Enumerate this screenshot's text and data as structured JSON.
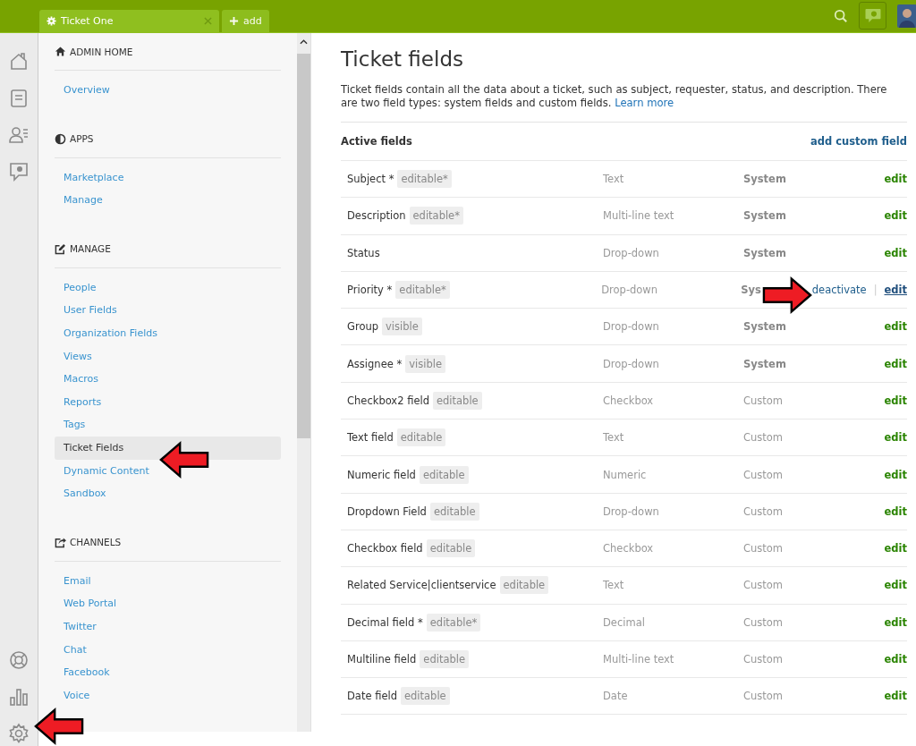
{
  "tabs": [
    {
      "label": "Ticket One",
      "selected": true,
      "closable": true
    },
    {
      "label": "add",
      "selected": false,
      "closable": false
    }
  ],
  "rail": {
    "top": [
      {
        "kind": "home"
      },
      {
        "kind": "tickets"
      },
      {
        "kind": "users"
      },
      {
        "kind": "chat"
      }
    ],
    "bottom": [
      {
        "kind": "help"
      },
      {
        "kind": "chart"
      },
      {
        "kind": "gear"
      }
    ]
  },
  "sidebar": {
    "sections": [
      {
        "kind": "home",
        "heading": "ADMIN HOME",
        "items": [
          {
            "label": "Overview",
            "selected": false
          }
        ]
      },
      {
        "kind": "apps",
        "heading": "APPS",
        "items": [
          {
            "label": "Marketplace",
            "selected": false
          },
          {
            "label": "Manage",
            "selected": false
          }
        ]
      },
      {
        "kind": "edit",
        "heading": "MANAGE",
        "items": [
          {
            "label": "People",
            "selected": false
          },
          {
            "label": "User Fields",
            "selected": false
          },
          {
            "label": "Organization Fields",
            "selected": false
          },
          {
            "label": "Views",
            "selected": false
          },
          {
            "label": "Macros",
            "selected": false
          },
          {
            "label": "Reports",
            "selected": false
          },
          {
            "label": "Tags",
            "selected": false
          },
          {
            "label": "Ticket Fields",
            "selected": true
          },
          {
            "label": "Dynamic Content",
            "selected": false
          },
          {
            "label": "Sandbox",
            "selected": false
          }
        ]
      },
      {
        "kind": "share",
        "heading": "CHANNELS",
        "items": [
          {
            "label": "Email",
            "selected": false
          },
          {
            "label": "Web Portal",
            "selected": false
          },
          {
            "label": "Twitter",
            "selected": false
          },
          {
            "label": "Chat",
            "selected": false
          },
          {
            "label": "Facebook",
            "selected": false
          },
          {
            "label": "Voice",
            "selected": false
          }
        ]
      }
    ]
  },
  "page": {
    "title": "Ticket fields",
    "description": "Ticket fields contain all the data about a ticket, such as subject, requester, status, and description. There are two field types: system fields and custom fields.",
    "learn_more": "Learn more"
  },
  "table": {
    "heading": "Active fields",
    "add_link": "add custom field",
    "rows": [
      {
        "name": "Subject *",
        "tag": "editable*",
        "type": "Text",
        "category": "System",
        "kind": "system",
        "hovered": false,
        "action": "edit"
      },
      {
        "name": "Description",
        "tag": "editable*",
        "type": "Multi-line text",
        "category": "System",
        "kind": "system",
        "hovered": false,
        "action": "edit"
      },
      {
        "name": "Status",
        "type": "Drop-down",
        "category": "System",
        "kind": "system",
        "hovered": false,
        "action": "edit"
      },
      {
        "name": "Priority *",
        "tag": "editable*",
        "type": "Drop-down",
        "category": "Sys",
        "kind": "system",
        "hovered": true,
        "deactivate": "deactivate",
        "separator": "|",
        "action": "edit"
      },
      {
        "name": "Group",
        "tag": "visible",
        "type": "Drop-down",
        "category": "System",
        "kind": "system",
        "hovered": false,
        "action": "edit"
      },
      {
        "name": "Assignee *",
        "tag": "visible",
        "type": "Drop-down",
        "category": "System",
        "kind": "system",
        "hovered": false,
        "action": "edit"
      },
      {
        "name": "Checkbox2 field",
        "tag": "editable",
        "type": "Checkbox",
        "category": "Custom",
        "kind": "custom",
        "hovered": false,
        "action": "edit"
      },
      {
        "name": "Text field",
        "tag": "editable",
        "type": "Text",
        "category": "Custom",
        "kind": "custom",
        "hovered": false,
        "action": "edit"
      },
      {
        "name": "Numeric field",
        "tag": "editable",
        "type": "Numeric",
        "category": "Custom",
        "kind": "custom",
        "hovered": false,
        "action": "edit"
      },
      {
        "name": "Dropdown Field",
        "tag": "editable",
        "type": "Drop-down",
        "category": "Custom",
        "kind": "custom",
        "hovered": false,
        "action": "edit"
      },
      {
        "name": "Checkbox field",
        "tag": "editable",
        "type": "Checkbox",
        "category": "Custom",
        "kind": "custom",
        "hovered": false,
        "action": "edit"
      },
      {
        "name": "Related Service|clientservice",
        "tag": "editable",
        "type": "Text",
        "category": "Custom",
        "kind": "custom",
        "hovered": false,
        "action": "edit"
      },
      {
        "name": "Decimal field *",
        "tag": "editable*",
        "type": "Decimal",
        "category": "Custom",
        "kind": "custom",
        "hovered": false,
        "action": "edit"
      },
      {
        "name": "Multiline field",
        "tag": "editable",
        "type": "Multi-line text",
        "category": "Custom",
        "kind": "custom",
        "hovered": false,
        "action": "edit"
      },
      {
        "name": "Date field",
        "tag": "editable",
        "type": "Date",
        "category": "Custom",
        "kind": "custom",
        "hovered": false,
        "action": "edit"
      }
    ]
  }
}
